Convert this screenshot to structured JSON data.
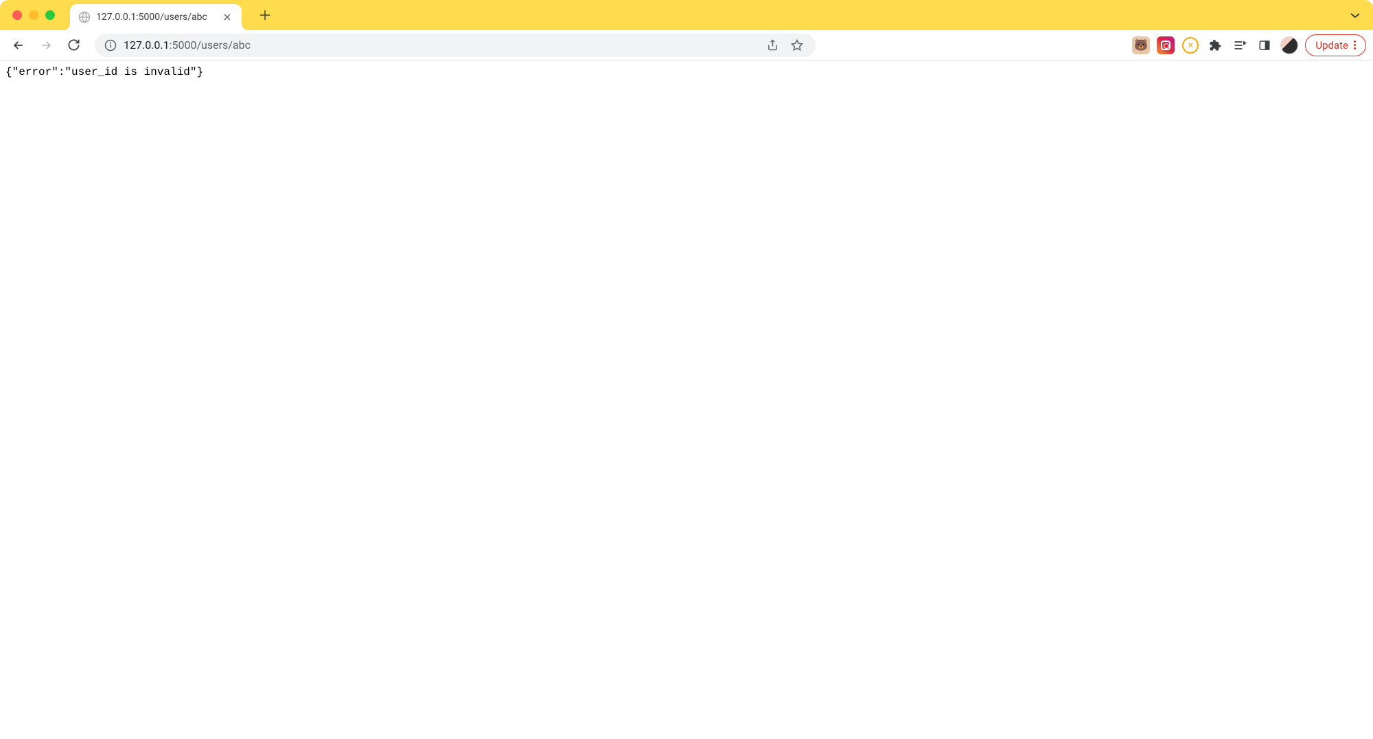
{
  "window": {
    "tab_title": "127.0.0.1:5000/users/abc"
  },
  "url": {
    "host": "127.0.0.1",
    "path": ":5000/users/abc"
  },
  "toolbar": {
    "update_label": "Update"
  },
  "page": {
    "body_text": "{\"error\":\"user_id is invalid\"}"
  }
}
